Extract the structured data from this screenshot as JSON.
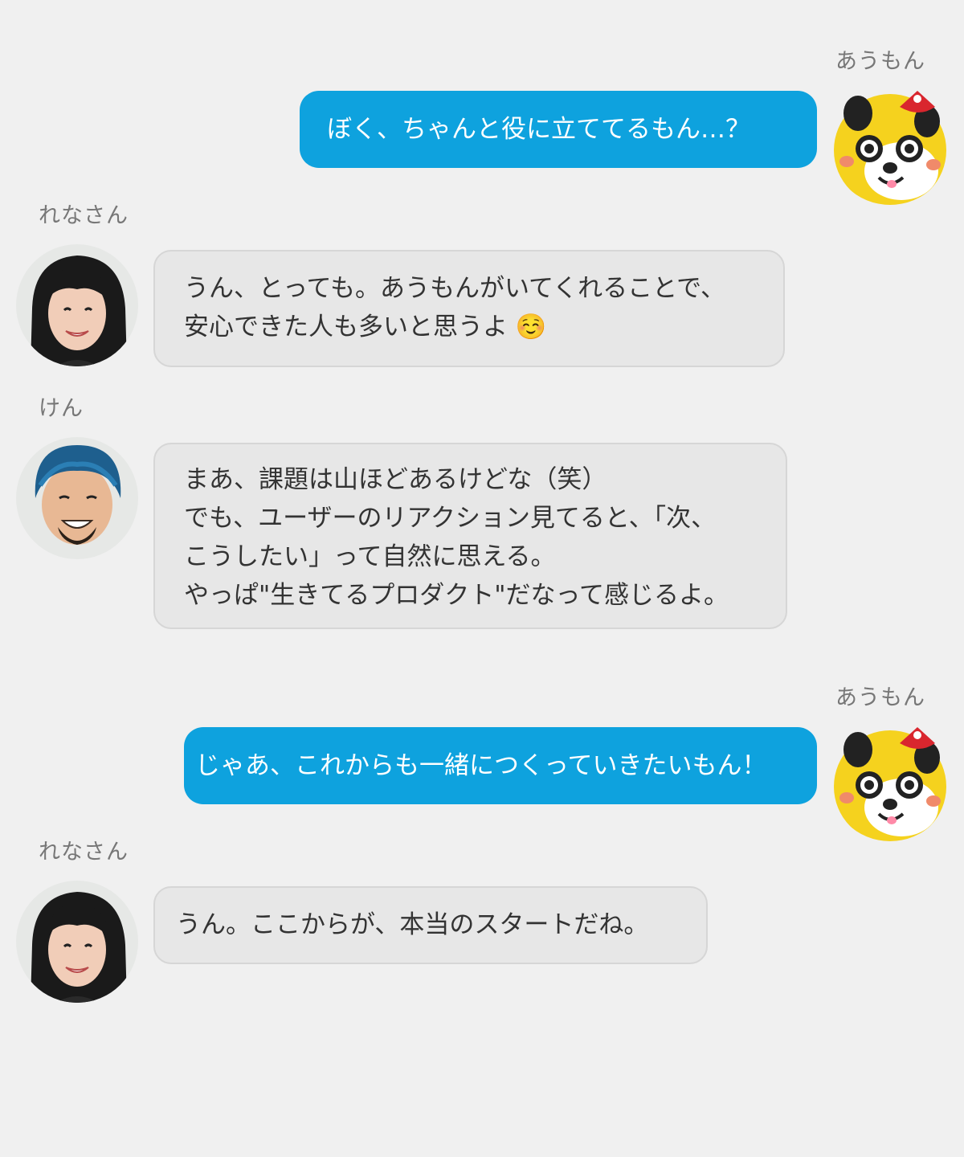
{
  "messages": [
    {
      "sender": "あうもん",
      "side": "right",
      "avatar": "aumon-mascot-avatar",
      "lines": [
        "ぼく、ちゃんと役に立ててるもん…？"
      ]
    },
    {
      "sender": "れなさん",
      "side": "left",
      "avatar": "rena-avatar",
      "lines": [
        "うん、とっても。あうもんがいてくれることで、",
        "安心できた人も多いと思うよ ☺️"
      ]
    },
    {
      "sender": "けん",
      "side": "left",
      "avatar": "ken-avatar",
      "lines": [
        "まあ、課題は山ほどあるけどな（笑）",
        "でも、ユーザーのリアクション見てると、「次、",
        "こうしたい」って自然に思える。",
        "やっぱ\"生きてるプロダクト\"だなって感じるよ。"
      ]
    },
    {
      "sender": "あうもん",
      "side": "right",
      "avatar": "aumon-mascot-avatar",
      "lines": [
        "じゃあ、これからも一緒につくっていきたいもん！"
      ]
    },
    {
      "sender": "れなさん",
      "side": "left",
      "avatar": "rena-avatar",
      "lines": [
        "うん。ここからが、本当のスタートだね。"
      ]
    }
  ],
  "colors": {
    "background": "#f0f0f0",
    "outgoing_bubble": "#0ea2de",
    "incoming_bubble": "#e7e7e7",
    "name_text": "#777777"
  }
}
